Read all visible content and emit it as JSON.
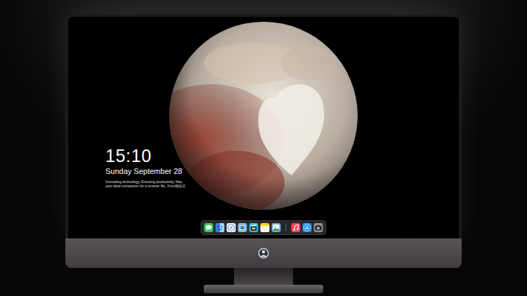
{
  "screen": {
    "clock": "15:10",
    "date": "Sunday September 28",
    "tagline": "Innovating technology, Ensuring productivity, Mac, your ideal companion for a smarter life, Xxxx精品店"
  },
  "dock": {
    "sections": [
      {
        "items": [
          {
            "kind": "messages",
            "color": "#34c759"
          },
          {
            "kind": "finder",
            "color": "#2f7fe0"
          },
          {
            "kind": "safari",
            "color": "#f2f2f2"
          },
          {
            "kind": "preview",
            "color": "#7fb4e6"
          },
          {
            "kind": "clips",
            "color": "#2bb3e8"
          },
          {
            "kind": "notes",
            "color": "#ffd60a"
          },
          {
            "kind": "photos",
            "color": "#5aa9e6"
          }
        ]
      },
      {
        "items": [
          {
            "kind": "music",
            "color": "#fc3c5a"
          },
          {
            "kind": "appstore",
            "color": "#1c8ef9"
          },
          {
            "kind": "camera",
            "color": "#8e8e93"
          }
        ]
      }
    ]
  }
}
